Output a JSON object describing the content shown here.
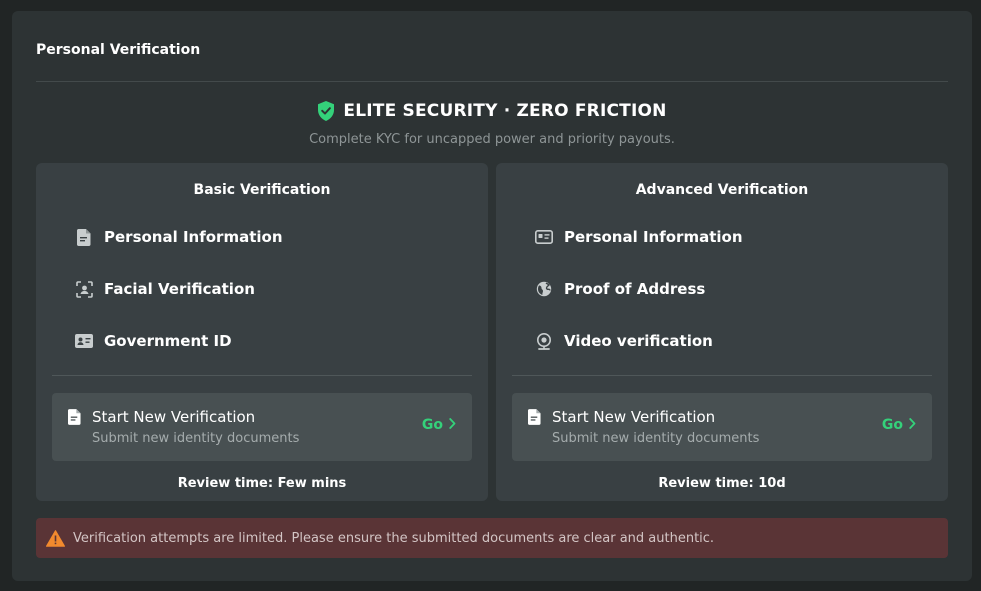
{
  "panel": {
    "title": "Personal Verification"
  },
  "hero": {
    "title": "ELITE SECURITY · ZERO FRICTION",
    "subtitle": "Complete KYC for uncapped power and priority payouts.",
    "icon": "shield-check-icon",
    "accent_color": "#34d17a"
  },
  "basic": {
    "title": "Basic Verification",
    "features": [
      {
        "label": "Personal Information",
        "icon": "document-icon"
      },
      {
        "label": "Facial Verification",
        "icon": "face-scan-icon"
      },
      {
        "label": "Government ID",
        "icon": "id-card-icon"
      }
    ],
    "action": {
      "title": "Start New Verification",
      "subtitle": "Submit new identity documents",
      "go_label": "Go"
    },
    "review": "Review time: Few mins"
  },
  "advanced": {
    "title": "Advanced Verification",
    "features": [
      {
        "label": "Personal Information",
        "icon": "id-card-icon"
      },
      {
        "label": "Proof of Address",
        "icon": "globe-icon"
      },
      {
        "label": "Video verification",
        "icon": "webcam-icon"
      }
    ],
    "action": {
      "title": "Start New Verification",
      "subtitle": "Submit new identity documents",
      "go_label": "Go"
    },
    "review": "Review time: 10d"
  },
  "warning": {
    "text": "Verification attempts are limited. Please ensure the submitted documents are clear and authentic.",
    "icon": "warning-triangle-icon",
    "color": "#f28a2e"
  }
}
